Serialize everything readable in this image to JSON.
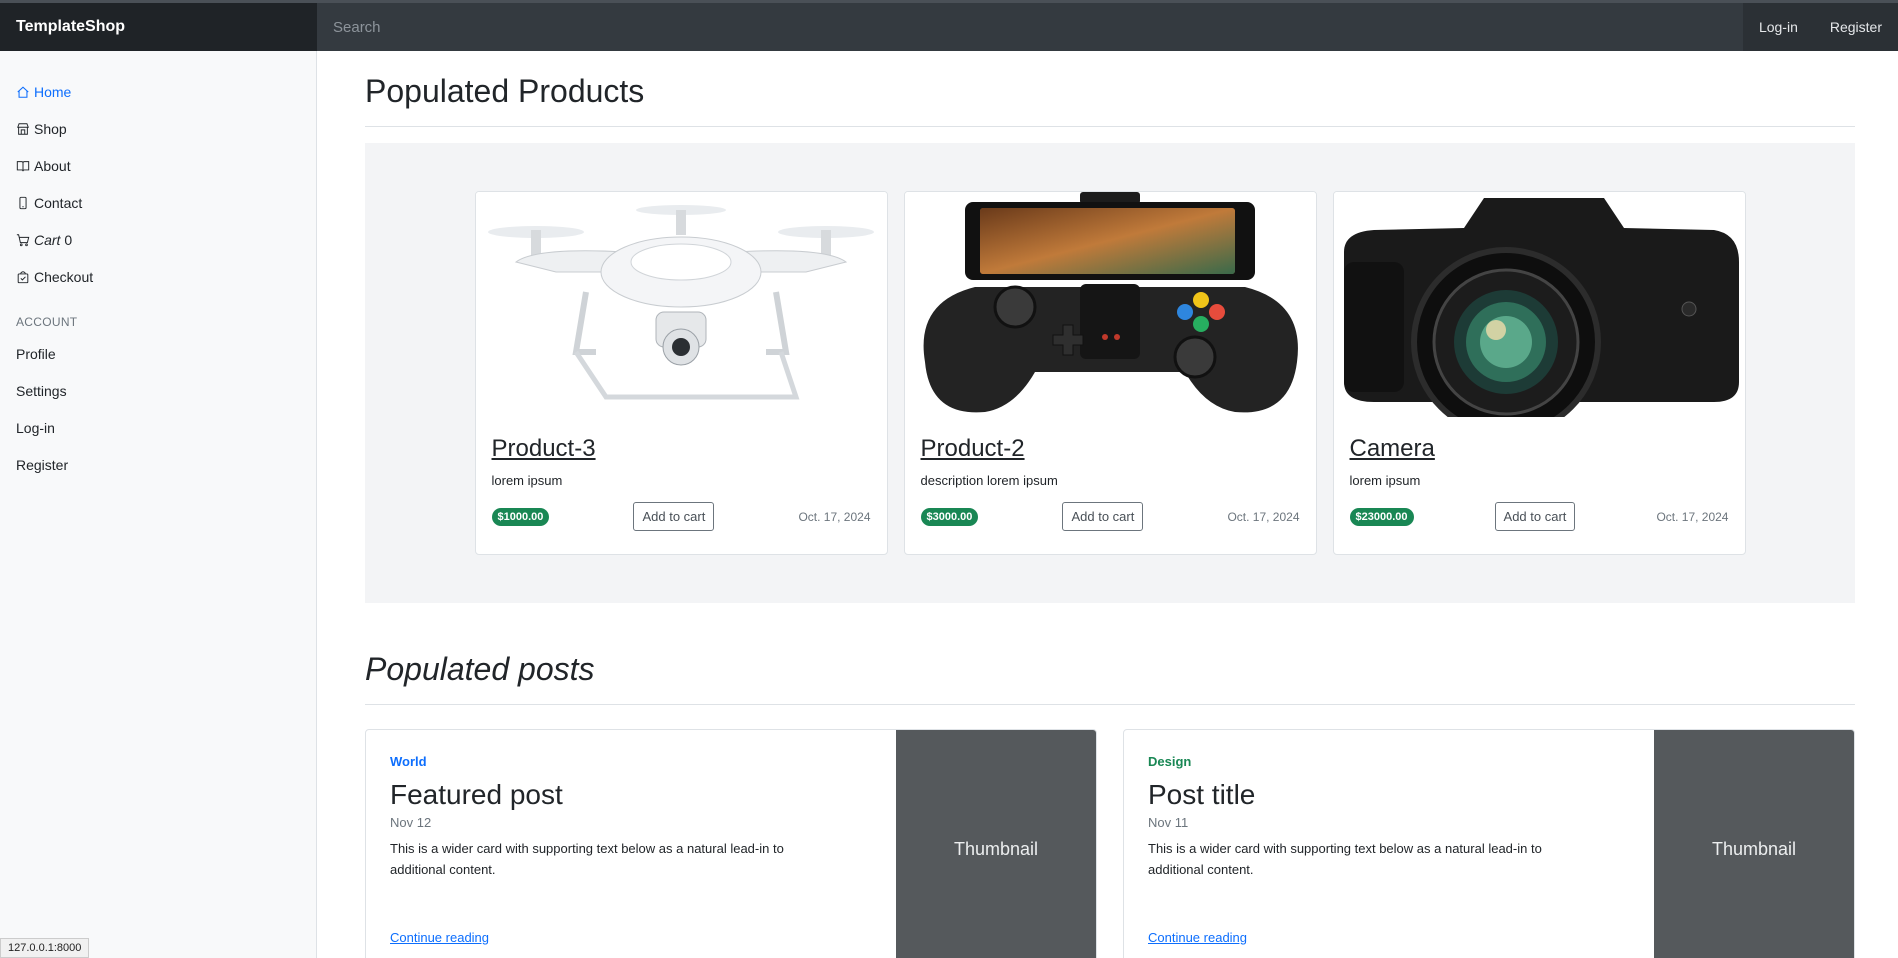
{
  "brand": "TemplateShop",
  "search": {
    "placeholder": "Search"
  },
  "top_nav": {
    "login": "Log-in",
    "register": "Register"
  },
  "sidebar": {
    "main_items": [
      {
        "label": "Home",
        "icon": "house-icon",
        "active": true
      },
      {
        "label": "Shop",
        "icon": "shop-icon"
      },
      {
        "label": "About",
        "icon": "book-icon"
      },
      {
        "label": "Contact",
        "icon": "phone-icon"
      },
      {
        "label": "Cart",
        "count": "0",
        "icon": "cart-icon"
      },
      {
        "label": "Checkout",
        "icon": "bag-check-icon"
      }
    ],
    "account_heading": "ACCOUNT",
    "account_items": [
      {
        "label": "Profile"
      },
      {
        "label": "Settings"
      },
      {
        "label": "Log-in"
      },
      {
        "label": "Register"
      }
    ]
  },
  "status_bar": "127.0.0.1:8000",
  "products_section": {
    "title": "Populated Products",
    "products": [
      {
        "name": "Product-3",
        "description": "lorem ipsum",
        "price": "$1000.00",
        "button": "Add to cart",
        "date": "Oct. 17, 2024",
        "image": "drone"
      },
      {
        "name": "Product-2",
        "description": "description lorem ipsum",
        "price": "$3000.00",
        "button": "Add to cart",
        "date": "Oct. 17, 2024",
        "image": "gamepad"
      },
      {
        "name": "Camera",
        "description": "lorem ipsum",
        "price": "$23000.00",
        "button": "Add to cart",
        "date": "Oct. 17, 2024",
        "image": "camera"
      }
    ]
  },
  "posts_section": {
    "title": "Populated posts",
    "posts": [
      {
        "category": "World",
        "title": "Featured post",
        "date": "Nov 12",
        "text": "This is a wider card with supporting text below as a natural lead-in to additional content.",
        "link": "Continue reading",
        "thumbnail": "Thumbnail"
      },
      {
        "category": "Design",
        "title": "Post title",
        "date": "Nov 11",
        "text": "This is a wider card with supporting text below as a natural lead-in to additional content.",
        "link": "Continue reading",
        "thumbnail": "Thumbnail"
      }
    ]
  },
  "colors": {
    "accent": "#0d6efd",
    "price_badge": "#198754",
    "topbar": "#343a40",
    "brand_bg": "#1f2327",
    "thumb": "#55595c"
  }
}
